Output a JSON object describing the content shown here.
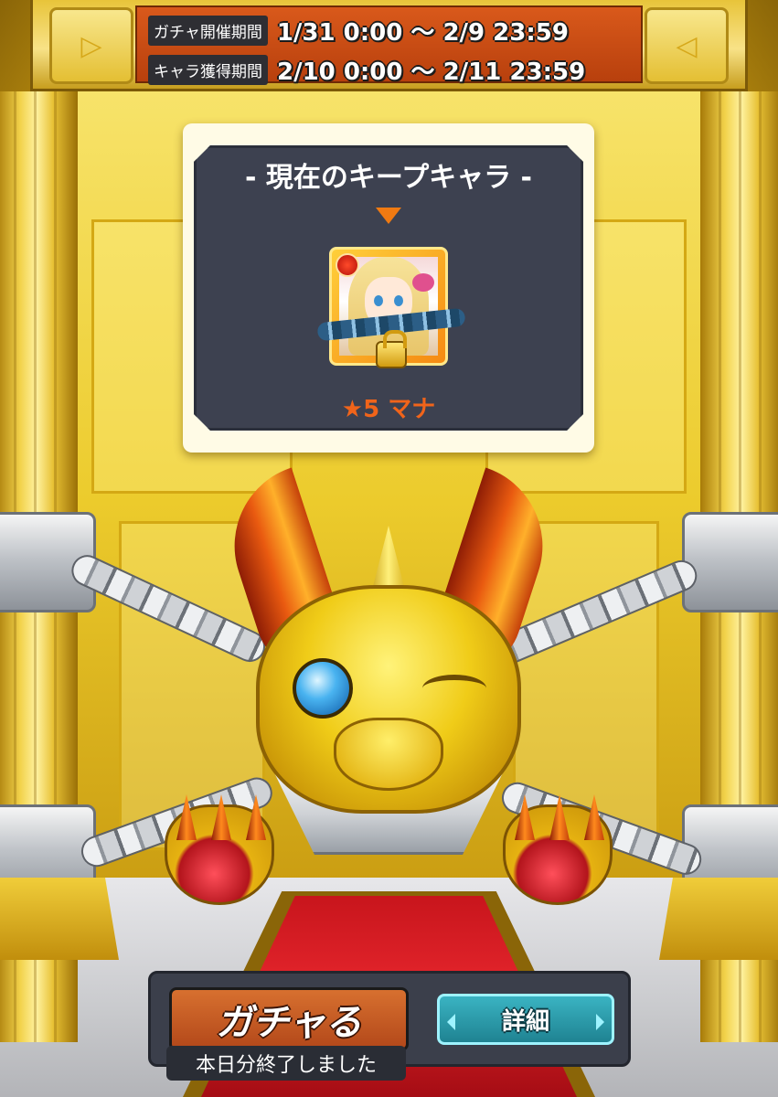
{
  "banner": {
    "gacha_period_label": "ガチャ開催期間",
    "gacha_period_value": "1/31 0:00 ～ 2/9 23:59",
    "char_period_label": "キャラ獲得期間",
    "char_period_value": "2/10 0:00 ～ 2/11 23:59"
  },
  "keep": {
    "title": "- 現在のキープキャラ -",
    "character_name": "★5 マナ"
  },
  "actions": {
    "gacha_label": "ガチャる",
    "detail_label": "詳細",
    "status_label": "本日分終了しました"
  },
  "colors": {
    "accent_orange": "#f1641a",
    "gacha_button": "#c75a22",
    "detail_button": "#2a9cac",
    "panel_dark": "#3d4150"
  },
  "icons": [
    "banner-left-arrow-icon",
    "banner-right-arrow-icon",
    "fire-attribute-icon",
    "padlock-icon",
    "chain-icon"
  ]
}
